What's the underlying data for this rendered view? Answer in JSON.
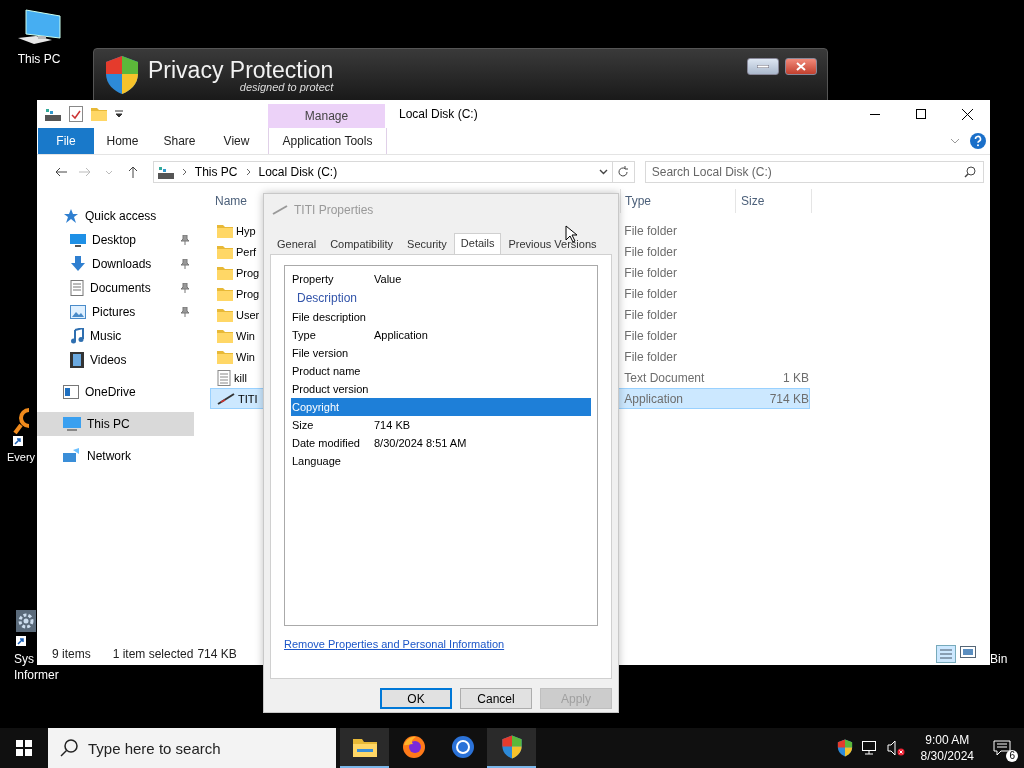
{
  "desktop_icons": [
    {
      "kind": "computer",
      "lines": [
        "This PC"
      ]
    },
    {
      "kind": "search-app",
      "lines": [
        "Every"
      ]
    },
    {
      "kind": "gear",
      "lines": [
        "Sys",
        "Informer"
      ]
    },
    {
      "kind": "bin",
      "lines": [
        "Bin"
      ]
    }
  ],
  "background_window": {
    "title": "Privacy Protection",
    "subtitle": "designed to protect"
  },
  "explorer": {
    "title": "Local Disk (C:)",
    "contextual_group": "Manage",
    "ribbon_tabs": [
      {
        "label": "File",
        "kind": "file"
      },
      {
        "label": "Home",
        "kind": "normal"
      },
      {
        "label": "Share",
        "kind": "normal"
      },
      {
        "label": "View",
        "kind": "normal"
      },
      {
        "label": "Application Tools",
        "kind": "contextual"
      }
    ],
    "breadcrumbs": [
      "This PC",
      "Local Disk (C:)"
    ],
    "search": {
      "placeholder": "Search Local Disk (C:)"
    },
    "nav": [
      {
        "label": "Quick access",
        "kind": "star",
        "selected": false,
        "children": [
          {
            "label": "Desktop",
            "kind": "desktop",
            "pinned": true,
            "selected": false
          },
          {
            "label": "Downloads",
            "kind": "download",
            "pinned": true,
            "selected": false
          },
          {
            "label": "Documents",
            "kind": "document",
            "pinned": true,
            "selected": false
          },
          {
            "label": "Pictures",
            "kind": "picture",
            "pinned": true,
            "selected": false
          },
          {
            "label": "Music",
            "kind": "music",
            "pinned": false,
            "selected": false
          },
          {
            "label": "Videos",
            "kind": "video",
            "pinned": false,
            "selected": false
          }
        ]
      },
      {
        "label": "OneDrive",
        "kind": "drive",
        "selected": false
      },
      {
        "label": "This PC",
        "kind": "computer",
        "selected": true
      },
      {
        "label": "Network",
        "kind": "network",
        "selected": false
      }
    ],
    "columns": [
      "Name",
      "Type",
      "Size"
    ],
    "rows": [
      {
        "name": "Hyp",
        "kind": "folder",
        "type": "File folder",
        "selected": false
      },
      {
        "name": "Perf",
        "kind": "folder",
        "type": "File folder",
        "selected": false
      },
      {
        "name": "Prog",
        "kind": "folder",
        "type": "File folder",
        "selected": false
      },
      {
        "name": "Prog",
        "kind": "folder",
        "type": "File folder",
        "selected": false
      },
      {
        "name": "User",
        "kind": "folder",
        "type": "File folder",
        "selected": false
      },
      {
        "name": "Win",
        "kind": "folder",
        "type": "File folder",
        "selected": false
      },
      {
        "name": "Win",
        "kind": "folder",
        "type": "File folder",
        "selected": false
      },
      {
        "name": "kill",
        "kind": "text",
        "type": "Text Document",
        "size": "1 KB",
        "selected": false
      },
      {
        "name": "TITI",
        "kind": "app",
        "type": "Application",
        "size": "714 KB",
        "selected": true
      }
    ],
    "status": {
      "count": "9 items",
      "selection": "1 item selected",
      "selection_size": "714 KB"
    }
  },
  "dialog": {
    "title": "TITI Properties",
    "tabs": [
      {
        "label": "General",
        "selected": false
      },
      {
        "label": "Compatibility",
        "selected": false
      },
      {
        "label": "Security",
        "selected": false
      },
      {
        "label": "Details",
        "selected": true
      },
      {
        "label": "Previous Versions",
        "selected": false
      }
    ],
    "columns": [
      "Property",
      "Value"
    ],
    "group": "Description",
    "rows": [
      {
        "property": "File description",
        "selected": false
      },
      {
        "property": "Type",
        "value": "Application",
        "selected": false
      },
      {
        "property": "File version",
        "selected": false
      },
      {
        "property": "Product name",
        "selected": false
      },
      {
        "property": "Product version",
        "selected": false
      },
      {
        "property": "Copyright",
        "selected": true
      },
      {
        "property": "Size",
        "value": "714 KB",
        "selected": false
      },
      {
        "property": "Date modified",
        "value": "8/30/2024 8:51 AM",
        "selected": false
      },
      {
        "property": "Language",
        "selected": false
      }
    ],
    "link": "Remove Properties and Personal Information",
    "buttons": [
      {
        "label": "OK",
        "default": true,
        "disabled": false
      },
      {
        "label": "Cancel",
        "default": false,
        "disabled": false
      },
      {
        "label": "Apply",
        "default": false,
        "disabled": true
      }
    ]
  },
  "taskbar": {
    "search": {
      "placeholder": "Type here to search"
    },
    "apps": [
      {
        "kind": "explorer",
        "active": true
      },
      {
        "kind": "firefox",
        "active": false
      },
      {
        "kind": "browser",
        "active": false
      },
      {
        "kind": "shield",
        "active": true
      }
    ],
    "time": "9:00 AM",
    "date": "8/30/2024",
    "notifications": "6"
  }
}
